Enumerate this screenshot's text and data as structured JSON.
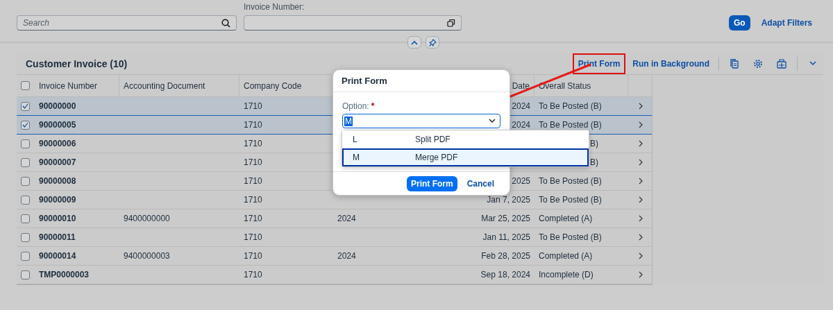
{
  "filter_bar": {
    "search": {
      "placeholder": "Search"
    },
    "invoice_field": {
      "label": "Invoice Number:"
    },
    "go": "Go",
    "adapt": "Adapt Filters"
  },
  "table": {
    "title": "Customer Invoice (10)",
    "actions": [
      "Print Form",
      "Run in Background"
    ],
    "columns": [
      "Invoice Number",
      "Accounting Document",
      "Company Code",
      "",
      "Date",
      "Overall Status"
    ],
    "all_checked": false,
    "rows": [
      {
        "invoice": "90000000",
        "accounting": "",
        "company": "1710",
        "column_4": "",
        "date": "2024",
        "status": "To Be Posted (B)",
        "status_partial": false,
        "selected": true
      },
      {
        "invoice": "90000005",
        "accounting": "",
        "company": "1710",
        "column_4": "",
        "date": "2024",
        "status": "To Be Posted (B)",
        "status_partial": false,
        "selected": true
      },
      {
        "invoice": "90000006",
        "accounting": "",
        "company": "1710",
        "column_4": "",
        "date": "",
        "status": "B)",
        "status_partial": true,
        "selected": false
      },
      {
        "invoice": "90000007",
        "accounting": "",
        "company": "1710",
        "column_4": "",
        "date": "",
        "status": "B)",
        "status_partial": true,
        "selected": false
      },
      {
        "invoice": "90000008",
        "accounting": "",
        "company": "1710",
        "column_4": "",
        "date": "2025",
        "status": "To Be Posted (B)",
        "status_partial": false,
        "selected": false
      },
      {
        "invoice": "90000009",
        "accounting": "",
        "company": "1710",
        "column_4": "",
        "date": "Jan 7, 2025",
        "status": "To Be Posted (B)",
        "status_partial": false,
        "selected": false
      },
      {
        "invoice": "90000010",
        "accounting": "9400000000",
        "company": "1710",
        "column_4": "2024",
        "date": "Mar 25, 2025",
        "status": "Completed (A)",
        "status_partial": false,
        "selected": false
      },
      {
        "invoice": "90000011",
        "accounting": "",
        "company": "1710",
        "column_4": "",
        "date": "Jan 11, 2025",
        "status": "To Be Posted (B)",
        "status_partial": false,
        "selected": false
      },
      {
        "invoice": "90000014",
        "accounting": "9400000003",
        "company": "1710",
        "column_4": "2024",
        "date": "Feb 28, 2025",
        "status": "Completed (A)",
        "status_partial": false,
        "selected": false
      },
      {
        "invoice": "TMP0000003",
        "accounting": "",
        "company": "1710",
        "column_4": "",
        "date": "Sep 18, 2024",
        "status": "Incomplete (D)",
        "status_partial": false,
        "selected": false
      }
    ]
  },
  "dialog": {
    "title": "Print Form",
    "label": "Option:",
    "required_mark": "*",
    "value": "M",
    "options": [
      {
        "key": "L",
        "text": "Split PDF",
        "selected": false
      },
      {
        "key": "M",
        "text": "Merge PDF",
        "selected": true
      }
    ],
    "buttons": [
      "Print Form",
      "Cancel"
    ]
  }
}
